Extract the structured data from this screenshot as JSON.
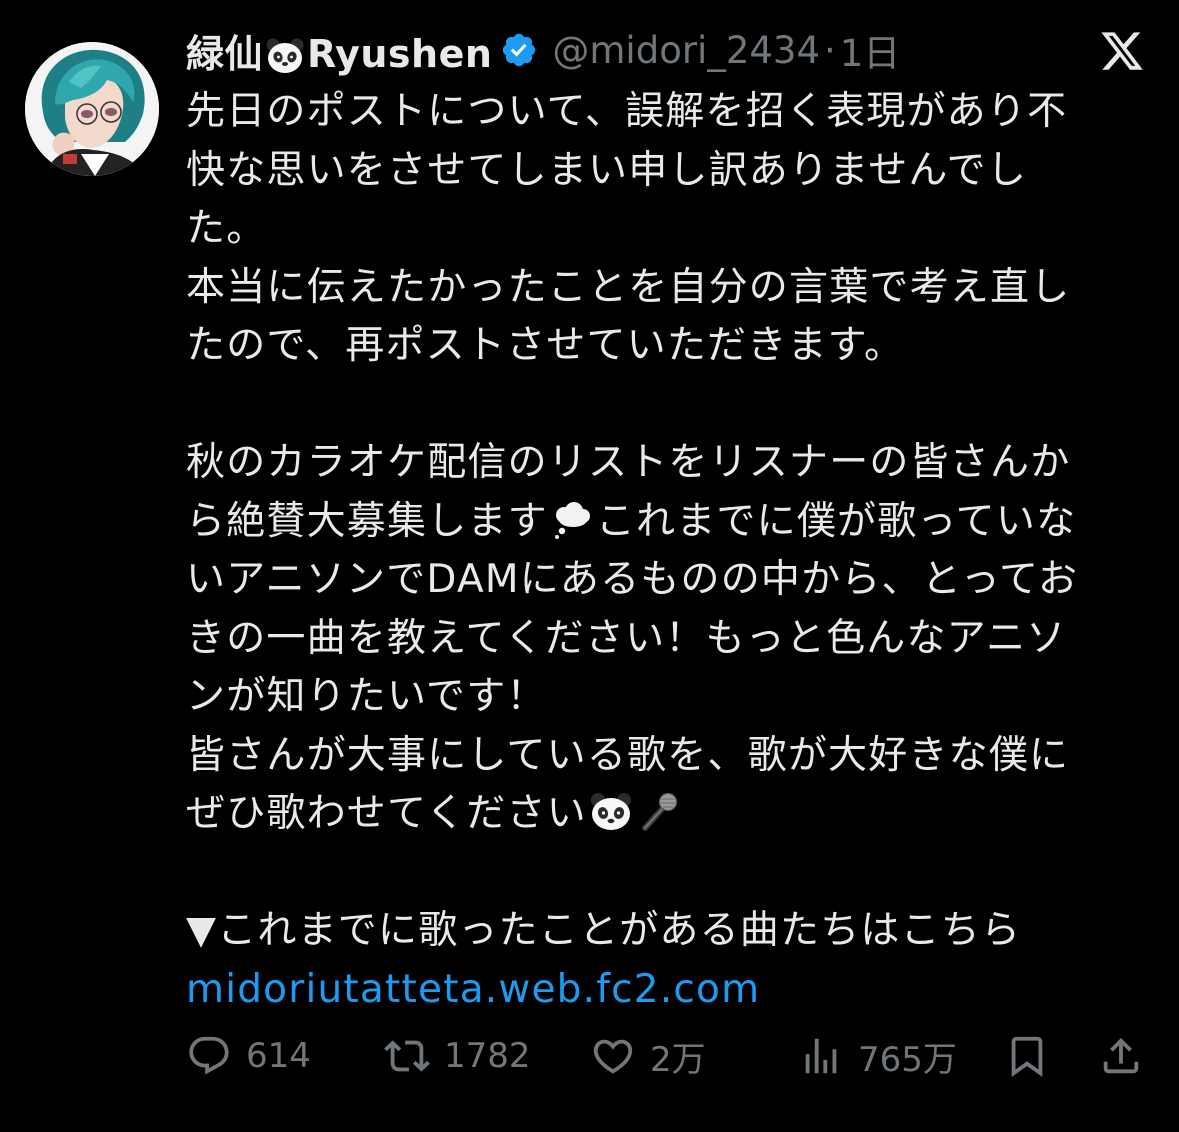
{
  "author": {
    "display_name_prefix": "緑仙",
    "display_name_emoji": "panda-face-emoji",
    "display_name_suffix": "Ryushen",
    "verified": true,
    "handle": "@midori_2434",
    "separator": "·",
    "time": "1日"
  },
  "platform_icon": "x-logo-icon",
  "post": {
    "lines": [
      "先日のポストについて、誤解を招く表現があり不",
      "快な思いをさせてしまい申し訳ありませんでし",
      "た。",
      "本当に伝えたかったことを自分の言葉で考え直し",
      "たので、再ポストさせていただきます。",
      "",
      "秋のカラオケ配信のリストをリスナーの皆さんか",
      "ら絶賛大募集します",
      "これまでに僕が歌っていな",
      "いアニソンでDAMにあるものの中から、とってお",
      "きの一曲を教えてください！もっと色んなアニソ",
      "ンが知りたいです！",
      "皆さんが大事にしている歌を、歌が大好きな僕に",
      "ぜひ歌わせてください",
      "",
      "▼これまでに歌ったことがある曲たちはこちら"
    ],
    "emojis": {
      "thought_balloon": "thought-balloon-emoji",
      "panda": "panda-face-emoji",
      "microphone": "microphone-emoji"
    },
    "link_text": "midoriutatteta.web.fc2.com"
  },
  "actions": {
    "replies": "614",
    "reposts": "1782",
    "likes": "2万",
    "views": "765万"
  },
  "colors": {
    "background": "#000000",
    "text": "#e7e9ea",
    "secondary_text": "#71767b",
    "link": "#1d9bf0",
    "verified_badge": "#1d9bf0"
  }
}
